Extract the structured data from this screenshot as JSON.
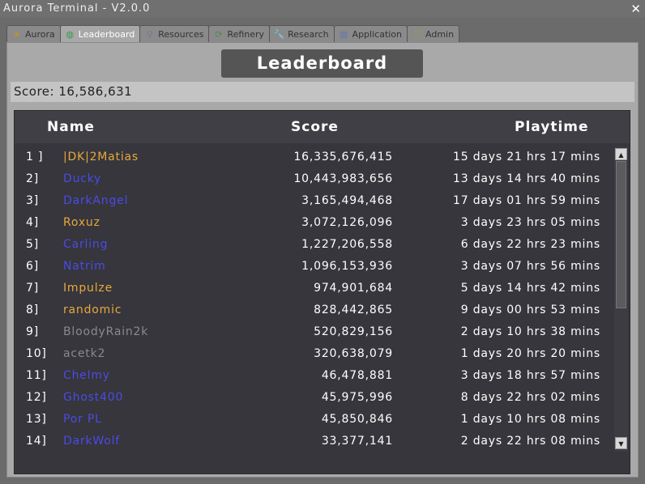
{
  "window": {
    "title": "Aurora Terminal - V2.0.0",
    "close": "✕"
  },
  "tabs": [
    {
      "label": "Aurora",
      "icon": "star-icon",
      "glyph": "★",
      "color": "#b8913a"
    },
    {
      "label": "Leaderboard",
      "icon": "globe-icon",
      "glyph": "◍",
      "color": "#3a9a4a"
    },
    {
      "label": "Resources",
      "icon": "magnifier-icon",
      "glyph": "⚲",
      "color": "#6a7a9a"
    },
    {
      "label": "Refinery",
      "icon": "recycle-icon",
      "glyph": "⟳",
      "color": "#4a8a4a"
    },
    {
      "label": "Research",
      "icon": "wrench-icon",
      "glyph": "🔧",
      "color": "#6a7aa8"
    },
    {
      "label": "Application",
      "icon": "grid-icon",
      "glyph": "▦",
      "color": "#6a7aa8"
    },
    {
      "label": "Admin",
      "icon": "shield-icon",
      "glyph": "⛉",
      "color": "#b8913a"
    }
  ],
  "active_tab": 1,
  "heading": "Leaderboard",
  "score_label": "Score: 16,586,631",
  "columns": {
    "name": "Name",
    "score": "Score",
    "playtime": "Playtime"
  },
  "colors": {
    "orange": "#e8a83c",
    "blue": "#4b4be6",
    "gray": "#8a8a8a"
  },
  "rows": [
    {
      "rank": "1 ]",
      "name": "|DK|2Matias",
      "color": "orange",
      "score": "16,335,676,415",
      "time": "15 days 21 hrs 17 mins"
    },
    {
      "rank": "2]",
      "name": "Ducky",
      "color": "blue",
      "score": "10,443,983,656",
      "time": "13 days 14 hrs 40 mins"
    },
    {
      "rank": "3]",
      "name": "DarkAngel",
      "color": "blue",
      "score": "3,165,494,468",
      "time": "17 days 01 hrs 59 mins"
    },
    {
      "rank": "4]",
      "name": "Roxuz",
      "color": "orange",
      "score": "3,072,126,096",
      "time": "3 days 23 hrs 05 mins"
    },
    {
      "rank": "5]",
      "name": "Carling",
      "color": "blue",
      "score": "1,227,206,558",
      "time": "6 days 22 hrs 23 mins"
    },
    {
      "rank": "6]",
      "name": "Natrim",
      "color": "blue",
      "score": "1,096,153,936",
      "time": "3 days 07 hrs 56 mins"
    },
    {
      "rank": "7]",
      "name": "Impulze",
      "color": "orange",
      "score": "974,901,684",
      "time": "5 days 14 hrs 42 mins"
    },
    {
      "rank": "8]",
      "name": "randomic",
      "color": "orange",
      "score": "828,442,865",
      "time": "9 days 00 hrs 53 mins"
    },
    {
      "rank": "9]",
      "name": "BloodyRain2k",
      "color": "gray",
      "score": "520,829,156",
      "time": "2 days 10 hrs 38 mins"
    },
    {
      "rank": "10]",
      "name": "acetk2",
      "color": "gray",
      "score": "320,638,079",
      "time": "1 days 20 hrs 20 mins"
    },
    {
      "rank": "11]",
      "name": "Chelmy",
      "color": "blue",
      "score": "46,478,881",
      "time": "3 days 18 hrs 57 mins"
    },
    {
      "rank": "12]",
      "name": "Ghost400",
      "color": "blue",
      "score": "45,975,996",
      "time": "8 days 22 hrs 02 mins"
    },
    {
      "rank": "13]",
      "name": "Por PL",
      "color": "blue",
      "score": "45,850,846",
      "time": "1 days 10 hrs 08 mins"
    },
    {
      "rank": "14]",
      "name": "DarkWolf",
      "color": "blue",
      "score": "33,377,141",
      "time": "2 days 22 hrs 08 mins"
    }
  ],
  "scrollbar": {
    "up": "▲",
    "down": "▼"
  }
}
